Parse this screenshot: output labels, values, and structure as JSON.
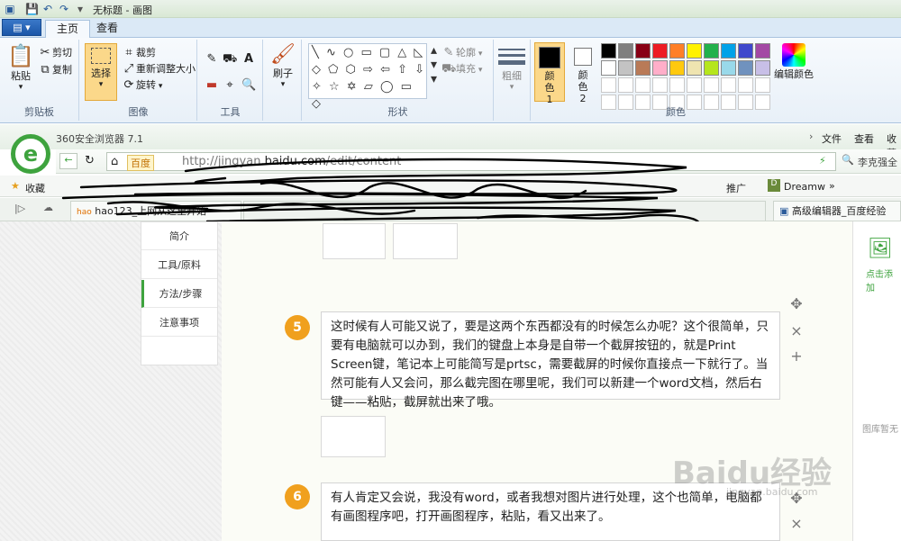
{
  "paint": {
    "window_title": "无标题 - 画图",
    "tabs": [
      {
        "label": "主页"
      },
      {
        "label": "查看"
      }
    ],
    "clipboard": {
      "paste": "粘贴",
      "cut": "剪切",
      "copy": "复制",
      "group": "剪贴板"
    },
    "image": {
      "select": "选择",
      "crop": "裁剪",
      "resize": "重新调整大小",
      "rotate": "旋转",
      "group": "图像"
    },
    "tools": {
      "group": "工具"
    },
    "brushes": {
      "label": "刷子"
    },
    "shapes": {
      "outline": "轮廓",
      "fill": "填充",
      "group": "形状"
    },
    "size": {
      "label": "粗细"
    },
    "colors": {
      "color1": "颜色 1",
      "color2": "颜色 2",
      "edit": "编辑颜色",
      "group": "颜色",
      "row1": [
        "#000000",
        "#7f7f7f",
        "#880015",
        "#ed1c24",
        "#ff7f27",
        "#fff200",
        "#22b14c",
        "#00a2e8",
        "#3f48cc",
        "#a349a4"
      ],
      "row2": [
        "#ffffff",
        "#c3c3c3",
        "#b97a57",
        "#ffaec9",
        "#ffc90e",
        "#efe4b0",
        "#b5e61d",
        "#99d9ea",
        "#7092be",
        "#c8bfe7"
      ]
    }
  },
  "browser": {
    "title": "360安全浏览器 7.1",
    "menu": [
      "文件",
      "查看",
      "收藏"
    ],
    "url_host": "http://jingyan.",
    "url_domain": "baidu.com",
    "url_path": "/edit/content",
    "search_engine": "百度",
    "user": "李克强全",
    "bookmarks_label": "收藏",
    "bookmark_items": [
      "推广",
      "Dreamw"
    ],
    "tabs": [
      {
        "title": "hao123_上网从这里开始"
      },
      {
        "title": "高级编辑器_百度经验"
      }
    ]
  },
  "page": {
    "nav": [
      "简介",
      "工具/原料",
      "方法/步骤",
      "注意事项"
    ],
    "right_add": "点击添加",
    "right_empty": "图库暂无",
    "steps": [
      {
        "num": "5",
        "text": "这时候有人可能又说了，要是这两个东西都没有的时候怎么办呢？这个很简单，只要有电脑就可以办到，我们的键盘上本身是自带一个截屏按钮的，就是Print Screen键，笔记本上可能简写是prtsc，需要截屏的时候你直接点一下就行了。当然可能有人又会问，那么截完图在哪里呢，我们可以新建一个word文档，然后右键——粘贴，截屏就出来了哦。"
      },
      {
        "num": "6",
        "text": "有人肯定又会说，我没有word，或者我想对图片进行处理，这个也简单，电脑都有画图程序吧，打开画图程序，粘贴，看又出来了。"
      }
    ],
    "watermark": "Baidu经验",
    "watermark_sub": "jingyan.baidu.com"
  }
}
